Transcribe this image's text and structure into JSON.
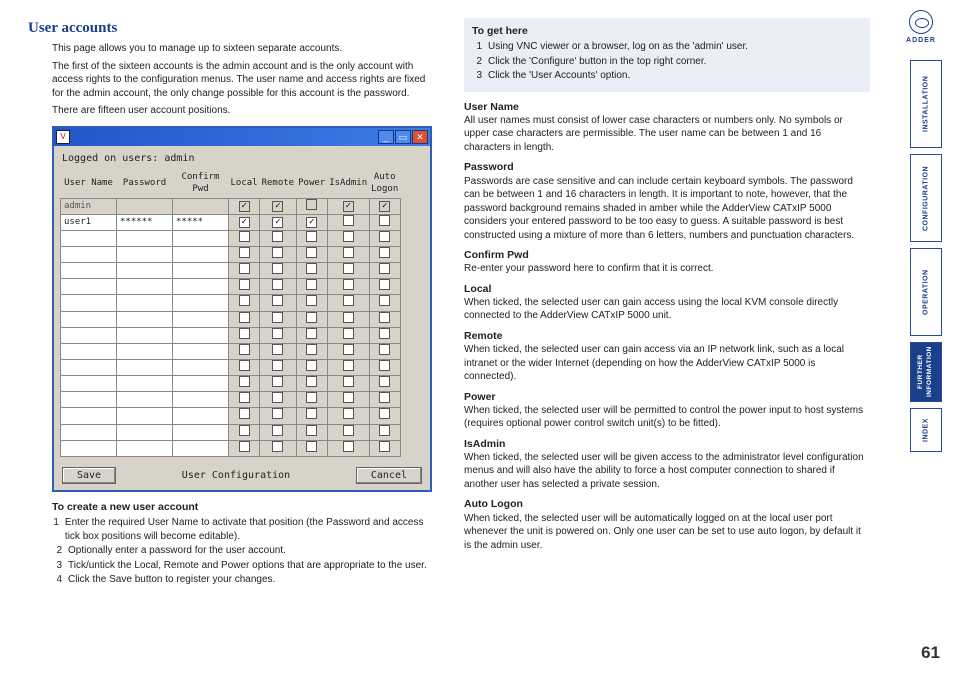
{
  "logo_text": "ADDER",
  "page_number": "61",
  "left": {
    "heading": "User accounts",
    "intro": [
      "This page allows you to manage up to sixteen separate accounts.",
      "The first of the sixteen accounts is the admin account and is the only account with access rights to the configuration menus. The user name and access rights are fixed for the admin account, the only change possible for this account is the password.",
      "There are fifteen user account positions."
    ],
    "create_heading": "To create a new user account",
    "create_steps": [
      "Enter the required User Name to activate that position (the Password and access tick box positions will become editable).",
      "Optionally enter a password for the user account.",
      "Tick/untick the Local, Remote and Power options that are appropriate to the user.",
      "Click the Save button to register your changes."
    ]
  },
  "window": {
    "logged_on_label": "Logged on users:",
    "logged_on_user": "admin",
    "headers": [
      "User Name",
      "Password",
      "Confirm Pwd",
      "Local",
      "Remote",
      "Power",
      "IsAdmin",
      "Auto Logon"
    ],
    "rows": [
      {
        "user": "admin",
        "pwd": "",
        "cpwd": "",
        "local": true,
        "remote": true,
        "power": false,
        "isadmin": true,
        "auto": true,
        "disabled": true
      },
      {
        "user": "user1",
        "pwd": "******",
        "cpwd": "*****",
        "local": true,
        "remote": true,
        "power": true,
        "isadmin": false,
        "auto": false,
        "disabled": false
      },
      {
        "user": "",
        "pwd": "",
        "cpwd": "",
        "local": false,
        "remote": false,
        "power": false,
        "isadmin": false,
        "auto": false,
        "disabled": false
      },
      {
        "user": "",
        "pwd": "",
        "cpwd": "",
        "local": false,
        "remote": false,
        "power": false,
        "isadmin": false,
        "auto": false,
        "disabled": false
      },
      {
        "user": "",
        "pwd": "",
        "cpwd": "",
        "local": false,
        "remote": false,
        "power": false,
        "isadmin": false,
        "auto": false,
        "disabled": false
      },
      {
        "user": "",
        "pwd": "",
        "cpwd": "",
        "local": false,
        "remote": false,
        "power": false,
        "isadmin": false,
        "auto": false,
        "disabled": false
      },
      {
        "user": "",
        "pwd": "",
        "cpwd": "",
        "local": false,
        "remote": false,
        "power": false,
        "isadmin": false,
        "auto": false,
        "disabled": false
      },
      {
        "user": "",
        "pwd": "",
        "cpwd": "",
        "local": false,
        "remote": false,
        "power": false,
        "isadmin": false,
        "auto": false,
        "disabled": false
      },
      {
        "user": "",
        "pwd": "",
        "cpwd": "",
        "local": false,
        "remote": false,
        "power": false,
        "isadmin": false,
        "auto": false,
        "disabled": false
      },
      {
        "user": "",
        "pwd": "",
        "cpwd": "",
        "local": false,
        "remote": false,
        "power": false,
        "isadmin": false,
        "auto": false,
        "disabled": false
      },
      {
        "user": "",
        "pwd": "",
        "cpwd": "",
        "local": false,
        "remote": false,
        "power": false,
        "isadmin": false,
        "auto": false,
        "disabled": false
      },
      {
        "user": "",
        "pwd": "",
        "cpwd": "",
        "local": false,
        "remote": false,
        "power": false,
        "isadmin": false,
        "auto": false,
        "disabled": false
      },
      {
        "user": "",
        "pwd": "",
        "cpwd": "",
        "local": false,
        "remote": false,
        "power": false,
        "isadmin": false,
        "auto": false,
        "disabled": false
      },
      {
        "user": "",
        "pwd": "",
        "cpwd": "",
        "local": false,
        "remote": false,
        "power": false,
        "isadmin": false,
        "auto": false,
        "disabled": false
      },
      {
        "user": "",
        "pwd": "",
        "cpwd": "",
        "local": false,
        "remote": false,
        "power": false,
        "isadmin": false,
        "auto": false,
        "disabled": false
      },
      {
        "user": "",
        "pwd": "",
        "cpwd": "",
        "local": false,
        "remote": false,
        "power": false,
        "isadmin": false,
        "auto": false,
        "disabled": false
      }
    ],
    "save_label": "Save",
    "caption": "User Configuration",
    "cancel_label": "Cancel"
  },
  "right": {
    "toget_heading": "To get here",
    "toget_steps": [
      "Using VNC viewer or a browser, log on as the 'admin' user.",
      "Click the 'Configure' button in the top right corner.",
      "Click the 'User Accounts' option."
    ],
    "defs": [
      {
        "title": "User Name",
        "body": "All user names must consist of lower case characters or numbers only. No symbols or upper case characters are permissible. The user name can be between 1 and 16 characters in length."
      },
      {
        "title": "Password",
        "body": "Passwords are case sensitive and can include certain keyboard symbols. The password can be between 1 and 16 characters in length. It is important to note, however, that the password background remains shaded in amber while the AdderView CATxIP 5000 considers your entered password to be too easy to guess. A suitable password is best constructed using a mixture of more than 6 letters, numbers and punctuation characters."
      },
      {
        "title": "Confirm Pwd",
        "body": "Re-enter your password here to confirm that it is correct."
      },
      {
        "title": "Local",
        "body": "When ticked, the selected user can gain access using the local KVM console directly connected to the AdderView CATxIP 5000 unit."
      },
      {
        "title": "Remote",
        "body": "When ticked, the selected user can gain access via an IP network link, such as a local intranet or the wider Internet (depending on how the AdderView CATxIP 5000 is connected)."
      },
      {
        "title": "Power",
        "body": "When ticked, the selected user will be permitted to control the power input to host systems (requires optional power control switch unit(s) to be fitted)."
      },
      {
        "title": "IsAdmin",
        "body": "When ticked, the selected user will be given access to the administrator level configuration menus and will also have the ability to force a host computer connection to shared if another user has selected a private session."
      },
      {
        "title": "Auto Logon",
        "body": "When ticked, the selected user will be automatically logged on at the local user port whenever the unit is powered on. Only one user can be set to use auto logon, by default it is the admin user."
      }
    ]
  },
  "tabs": [
    "INSTALLATION",
    "CONFIGURATION",
    "OPERATION",
    "FURTHER INFORMATION",
    "INDEX"
  ]
}
